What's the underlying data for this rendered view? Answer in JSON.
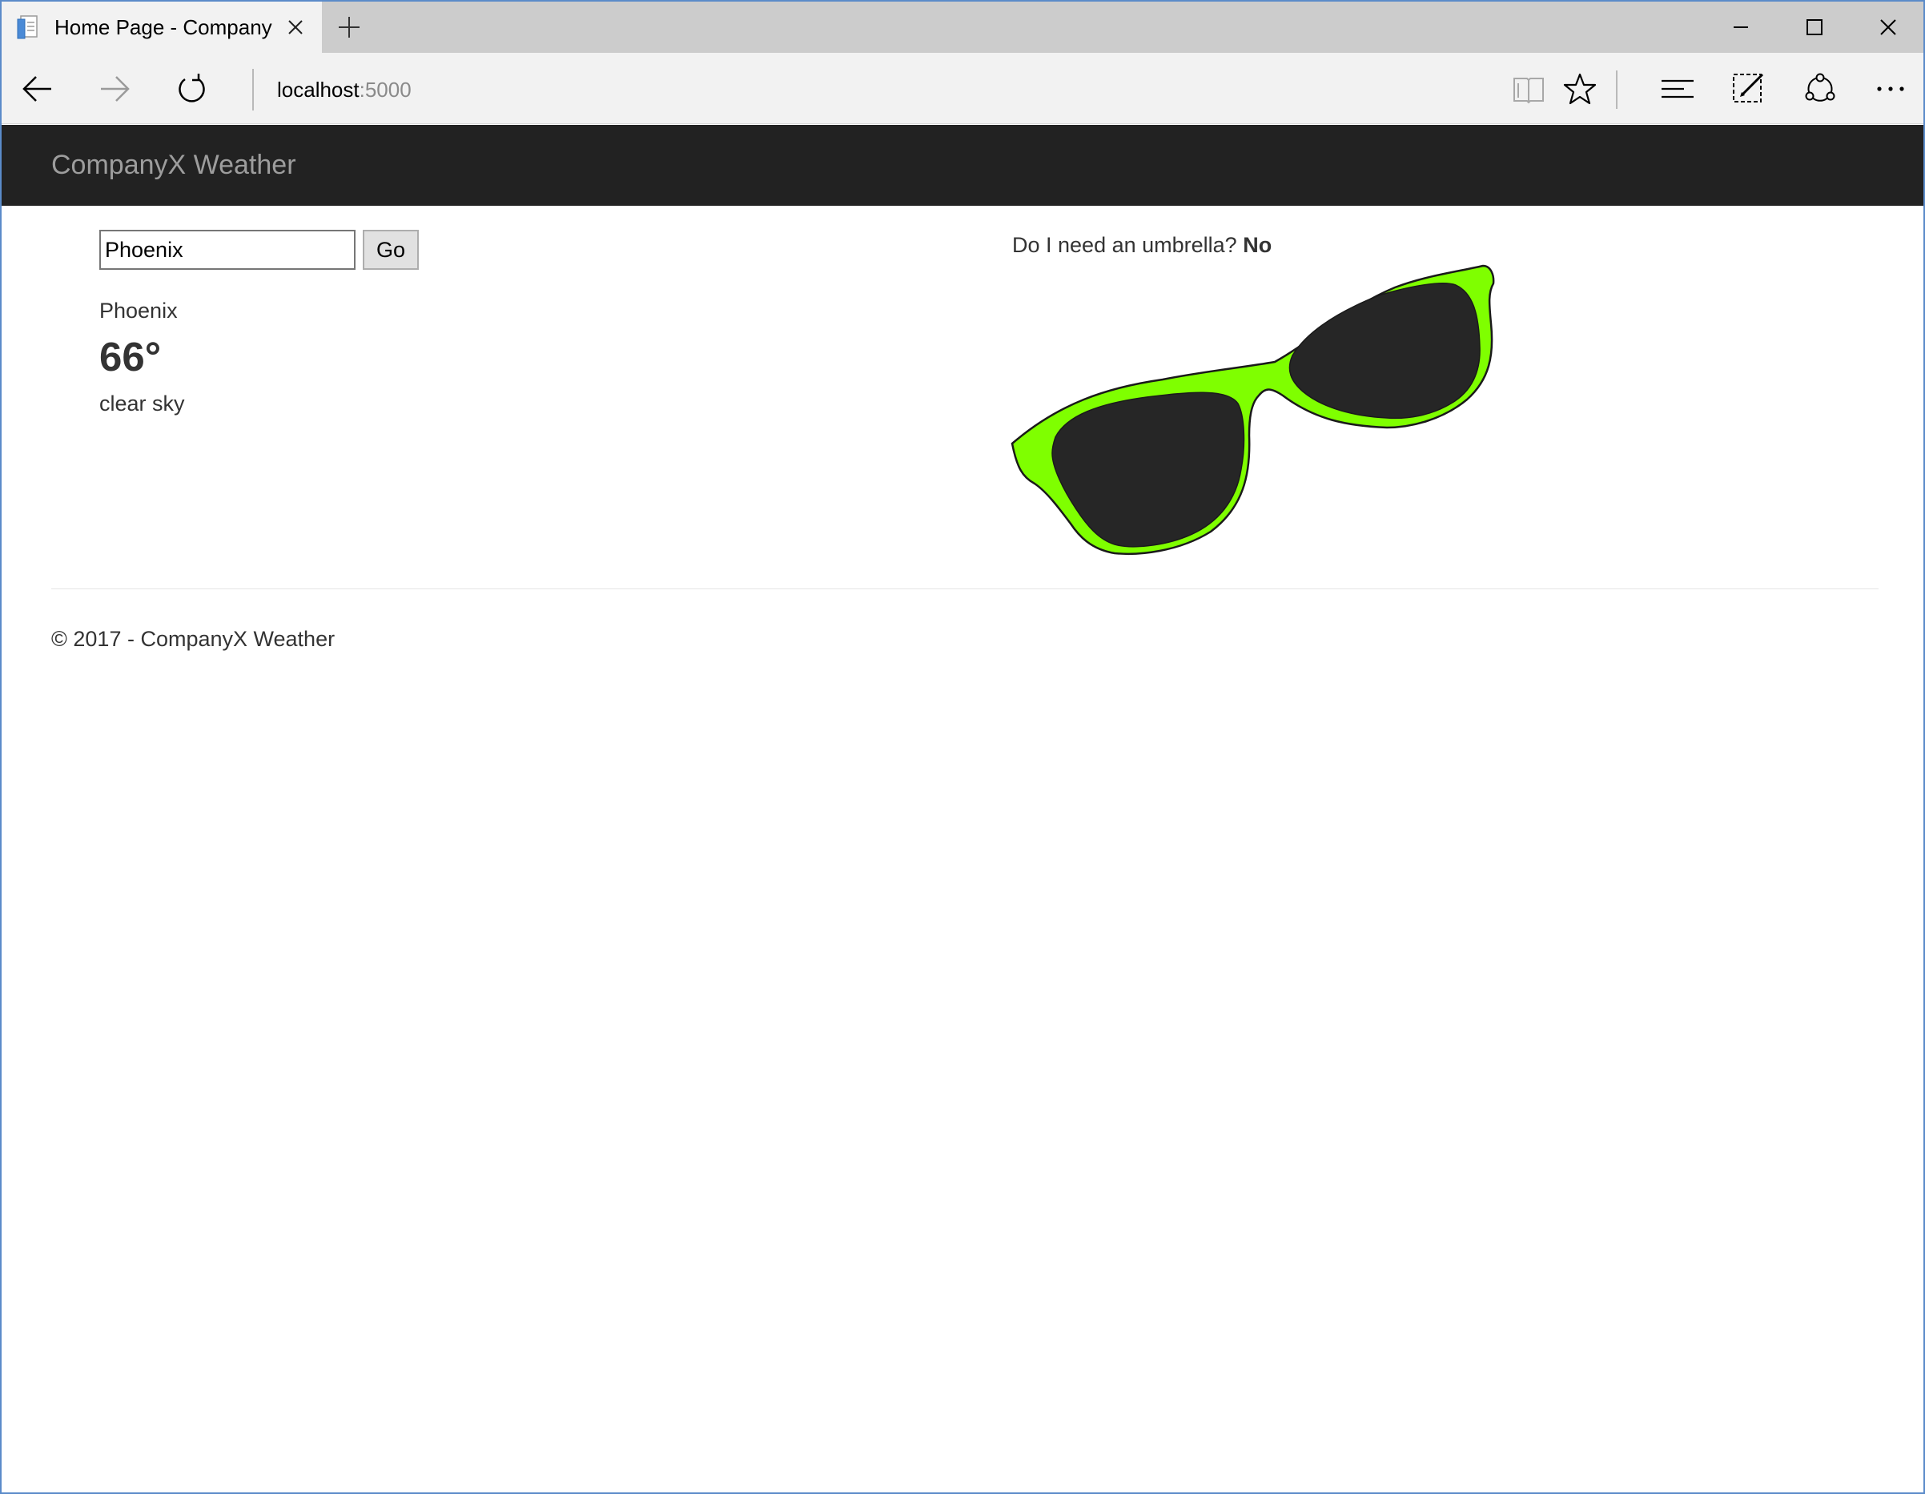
{
  "browser": {
    "tab": {
      "title": "Home Page - CompanyX Weather",
      "favicon": "page-icon"
    },
    "address": {
      "host": "localhost",
      "port": ":5000"
    },
    "icons": {
      "back": "back-arrow-icon",
      "forward": "forward-arrow-icon",
      "refresh": "refresh-icon",
      "reading_view": "reading-view-icon",
      "favorites": "star-icon",
      "hub": "hub-icon",
      "web_note": "web-note-icon",
      "share": "share-icon",
      "more": "more-icon",
      "new_tab": "plus-icon",
      "tab_close": "close-icon",
      "minimize": "minimize-icon",
      "maximize": "maximize-icon",
      "window_close": "close-icon"
    }
  },
  "site": {
    "brand": "CompanyX Weather",
    "header_color": "#222222",
    "brand_color": "#9d9d9d"
  },
  "search": {
    "value": "Phoenix",
    "button_label": "Go"
  },
  "weather": {
    "city": "Phoenix",
    "temperature": "66°",
    "description": "clear sky"
  },
  "umbrella": {
    "question": "Do I need an umbrella?",
    "answer": "No",
    "image": "sunglasses-illustration",
    "frame_color": "#7fff00",
    "lens_color": "#262626"
  },
  "footer": {
    "text": "© 2017 - CompanyX Weather"
  }
}
